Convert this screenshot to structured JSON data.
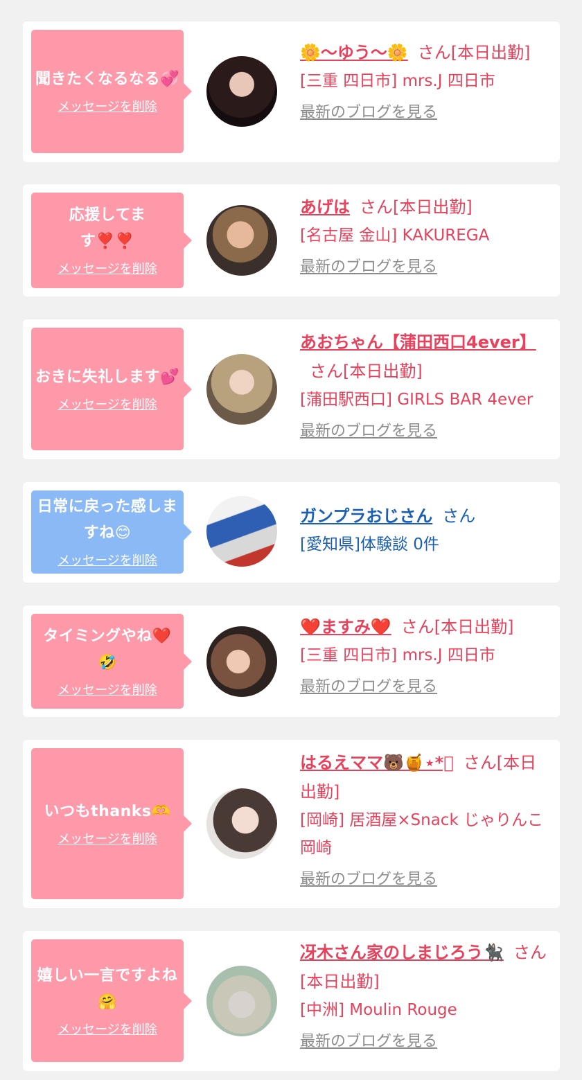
{
  "delete_label": "メッセージを削除",
  "blog_label": "最新のブログを見る",
  "cards": [
    {
      "message": "聞きたくなるなる💞",
      "name": "🌼〜ゆう〜🌼",
      "suffix": "さん[本日出勤]",
      "shop": "[三重 四日市] mrs.J 四日市"
    },
    {
      "message": "応援してます❣️❣️",
      "name": "あげは",
      "suffix": "さん[本日出勤]",
      "shop": "[名古屋 金山] KAKUREGA"
    },
    {
      "message": "おきに失礼します💕",
      "name": "あおちゃん【蒲田西口4ever】",
      "suffix": "さん[本日出勤]",
      "shop": "[蒲田駅西口] GIRLS BAR 4ever"
    },
    {
      "message": "日常に戻った感しますね😊",
      "name": "ガンプラおじさん",
      "suffix": "さん",
      "shop": "[愛知県]体験談 0件"
    },
    {
      "message": "タイミングやね❤️🤣",
      "name": "❤️ますみ❤️",
      "suffix": "さん[本日出勤]",
      "shop": "[三重 四日市] mrs.J 四日市"
    },
    {
      "message": "いつもthanks🫶",
      "name": "はるえママ🐻🍯⋆*゚",
      "suffix": "さん[本日出勤]",
      "shop": "[岡崎] 居酒屋×Snack じゃりんこ岡崎"
    },
    {
      "message": "嬉しい一言ですよね🤗",
      "name": "冴木さん家のしまじろう🐈‍⬛",
      "suffix": "さん[本日出勤]",
      "shop": "[中洲] Moulin Rouge"
    }
  ]
}
